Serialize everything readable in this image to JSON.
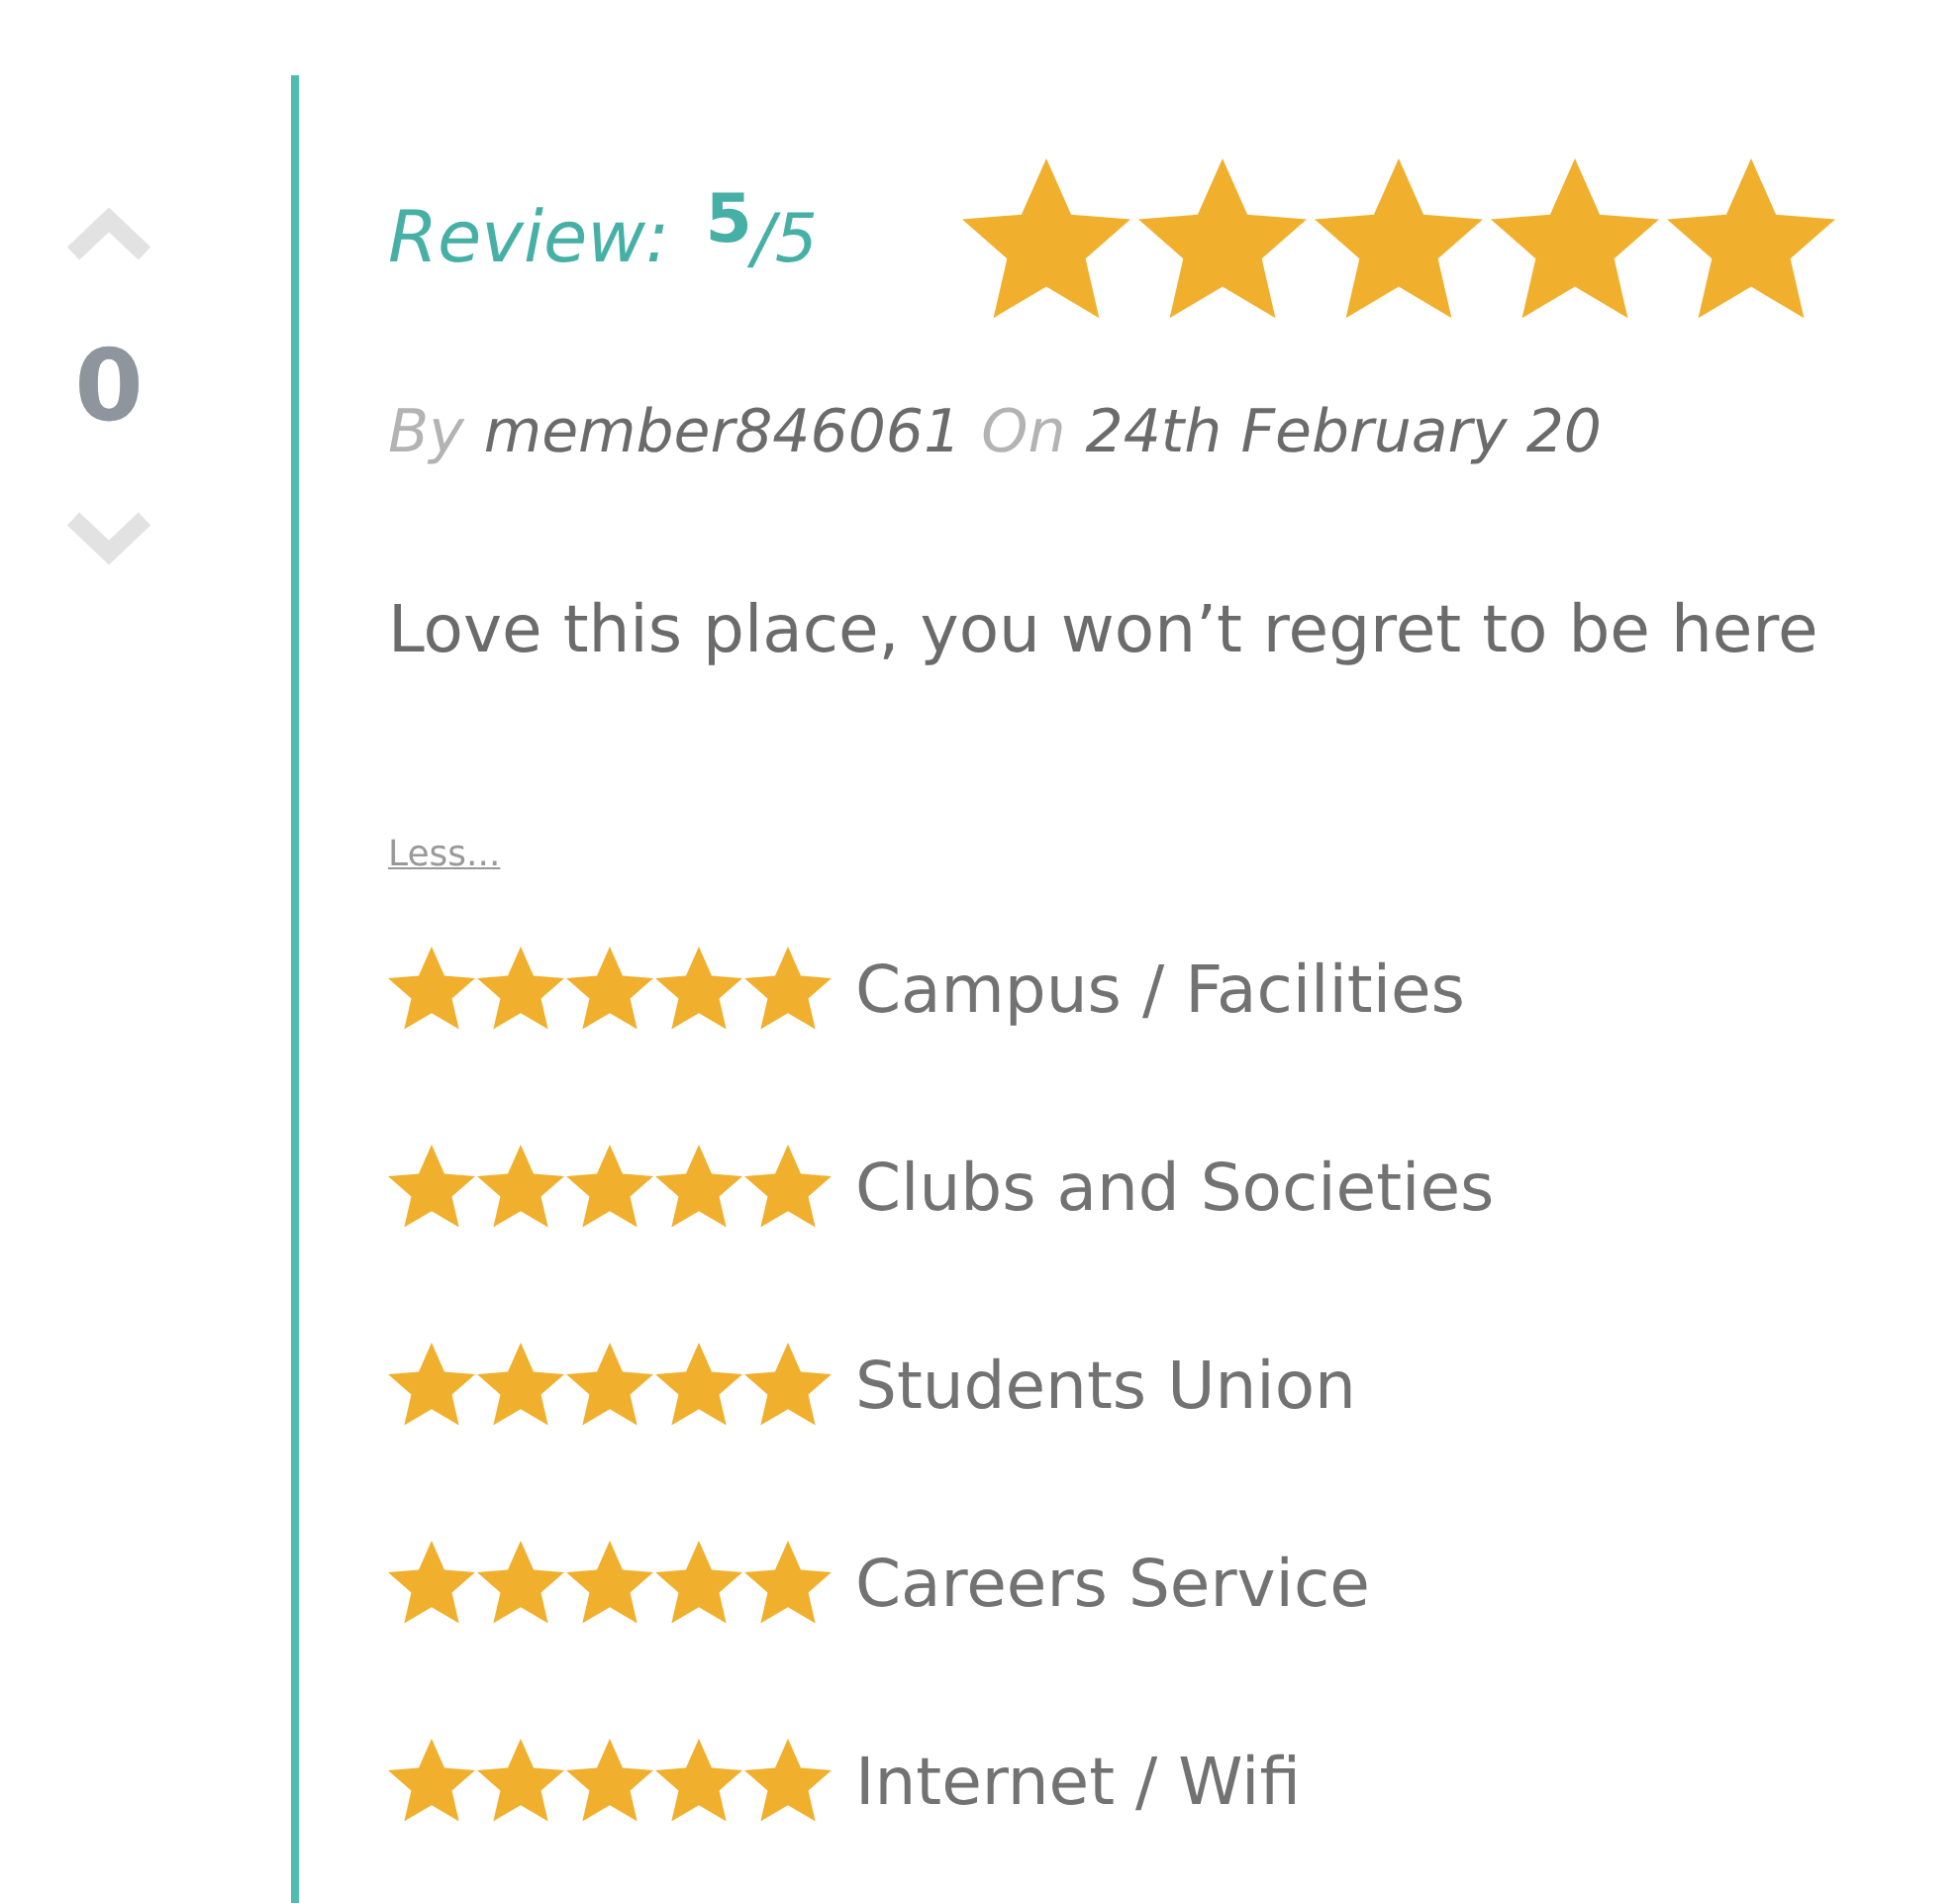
{
  "votes": {
    "count": "0"
  },
  "review": {
    "label": "Review:",
    "score": "5",
    "out_of": "/5",
    "stars": 5
  },
  "byline": {
    "by": "By",
    "author": "member846061",
    "on": "On",
    "date": "24th February 20"
  },
  "text": "Love this place, you won’t regret to be here",
  "less_link": "Less...",
  "ratings": [
    {
      "label": "Campus / Facilities",
      "stars": 5
    },
    {
      "label": "Clubs and Societies",
      "stars": 5
    },
    {
      "label": "Students Union",
      "stars": 5
    },
    {
      "label": "Careers Service",
      "stars": 5
    },
    {
      "label": "Internet / Wifi",
      "stars": 5
    }
  ]
}
